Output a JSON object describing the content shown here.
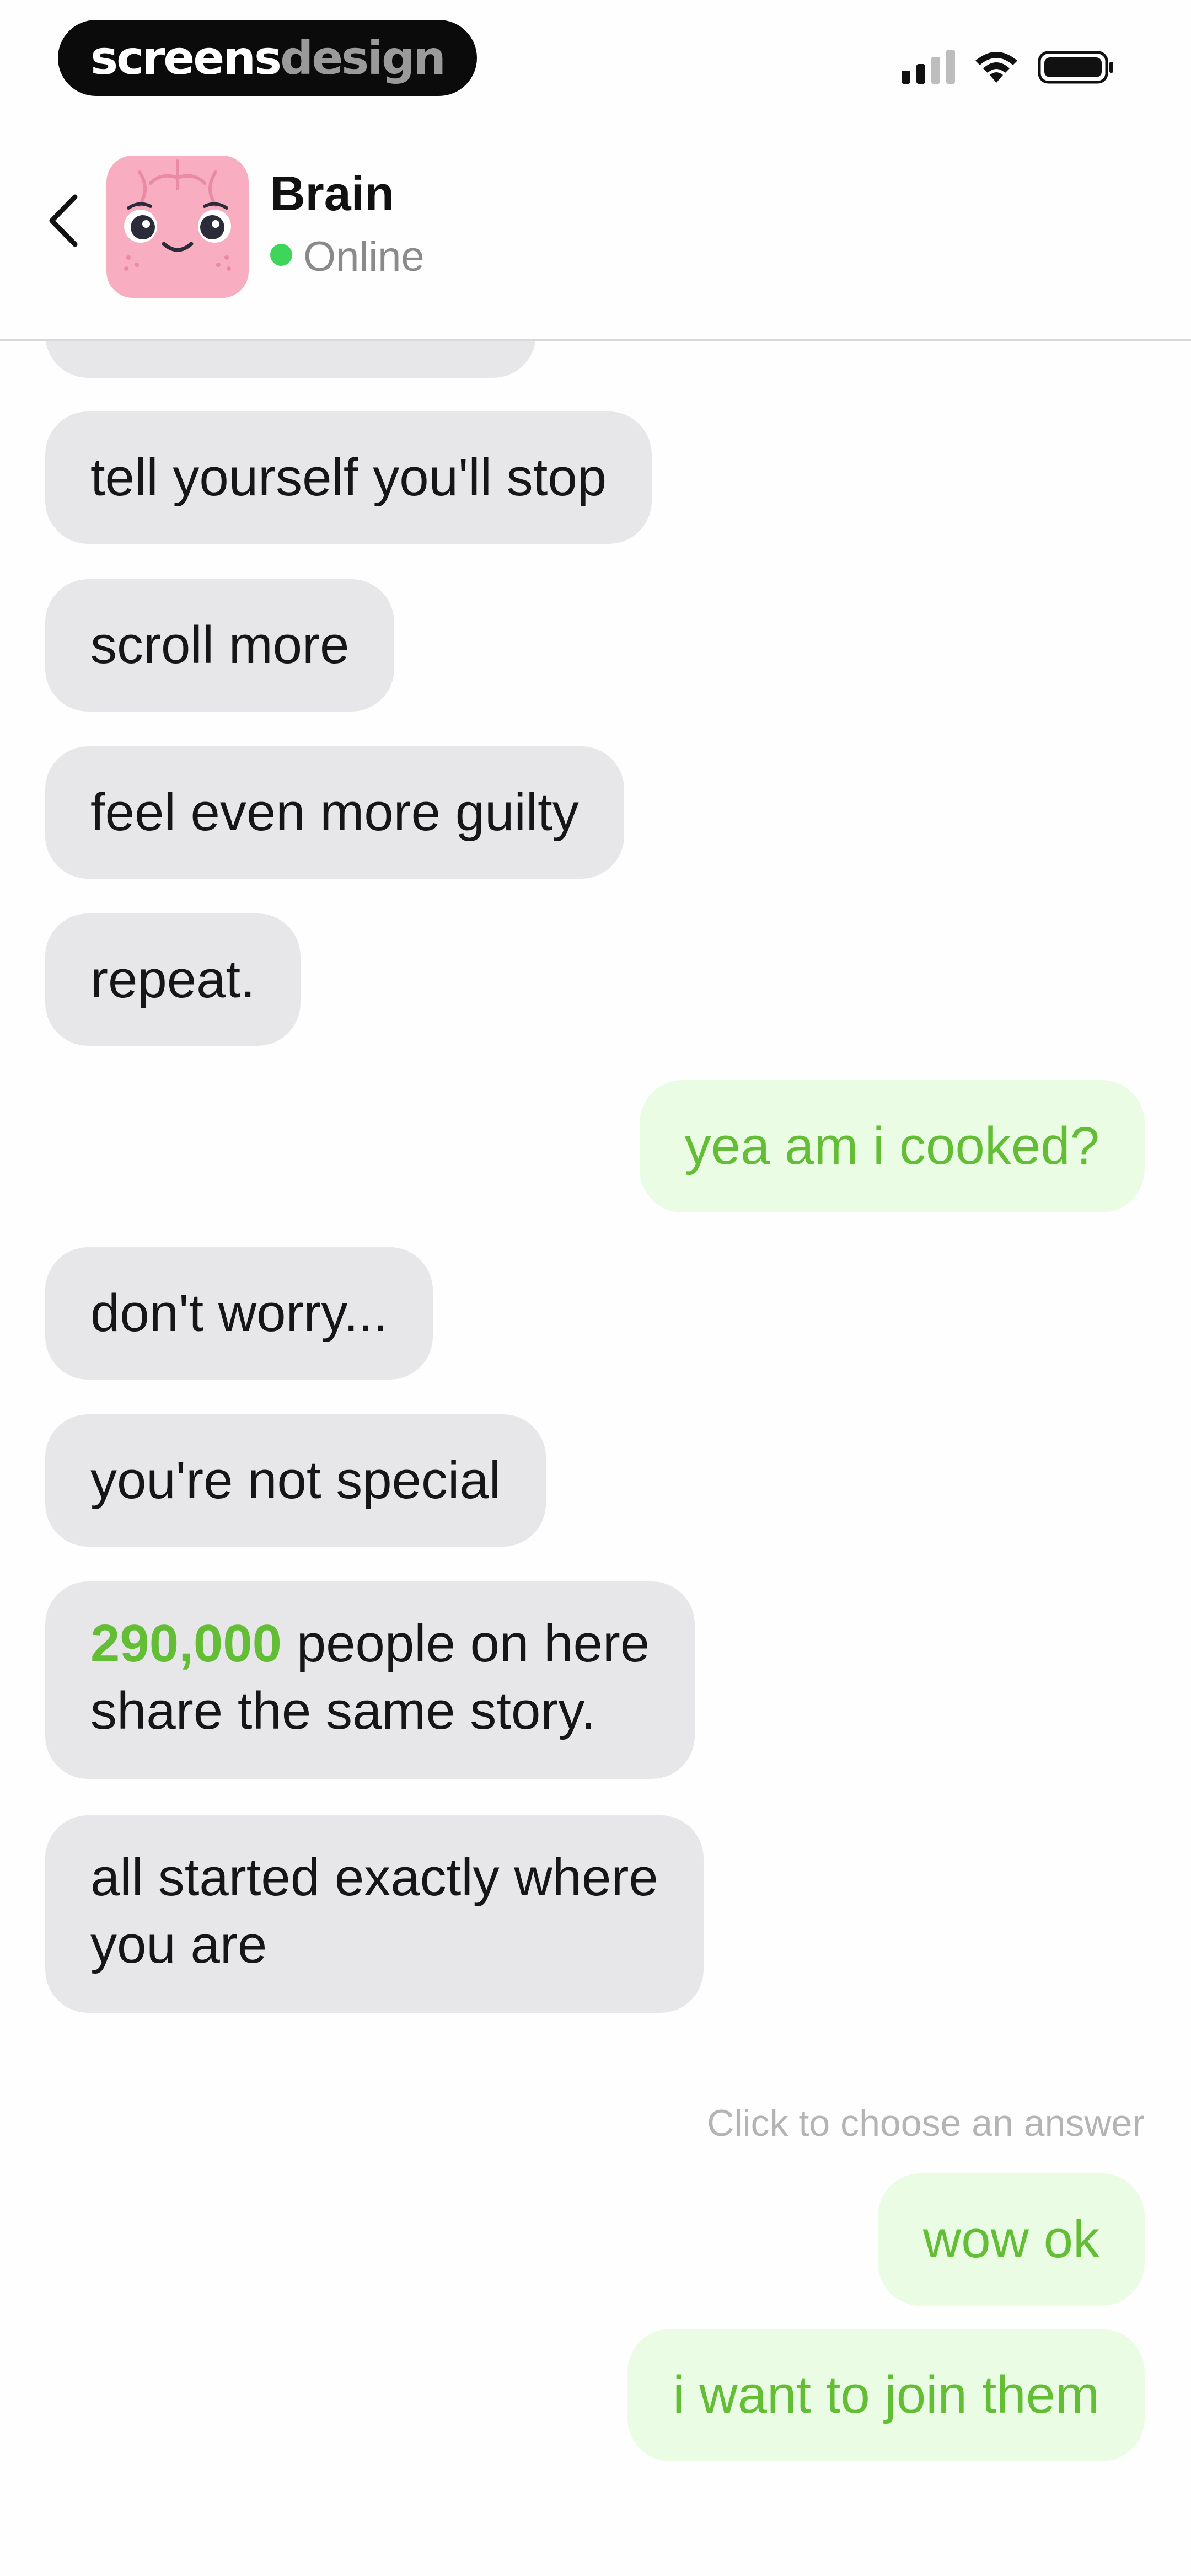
{
  "status_bar": {
    "brand_part1": "screens",
    "brand_part2": "design",
    "icons": [
      "signal-icon",
      "wifi-icon",
      "battery-icon"
    ]
  },
  "header": {
    "back_icon": "chevron-left-icon",
    "contact_name": "Brain",
    "status": "Online",
    "status_color": "#3ed65a"
  },
  "messages": [
    {
      "from": "bot",
      "text": "tell yourself you'll stop"
    },
    {
      "from": "bot",
      "text": "scroll more"
    },
    {
      "from": "bot",
      "text": "feel even more guilty"
    },
    {
      "from": "bot",
      "text": "repeat."
    },
    {
      "from": "user",
      "text": "yea am i cooked?"
    },
    {
      "from": "bot",
      "text": "don't worry..."
    },
    {
      "from": "bot",
      "text": "you're not special"
    },
    {
      "from": "bot",
      "highlight": "290,000",
      "text_line1_rest": " people on here",
      "text_line2": "share the same story."
    },
    {
      "from": "bot",
      "text_line1": "all started exactly where",
      "text_line2": "you are"
    }
  ],
  "answer_hint": "Click to choose an answer",
  "answers": [
    "wow ok",
    "i want to join them"
  ],
  "colors": {
    "accent_green": "#64be35",
    "user_bubble": "#eafde4",
    "bot_bubble": "#e7e7ea"
  }
}
